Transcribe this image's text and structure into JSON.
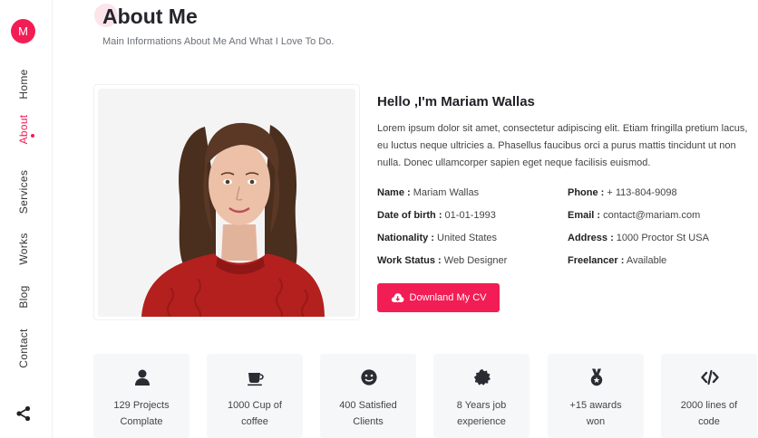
{
  "sidebar": {
    "logo_letter": "M",
    "items": [
      {
        "label": "Home"
      },
      {
        "label": "About"
      },
      {
        "label": "Services"
      },
      {
        "label": "Works"
      },
      {
        "label": "Blog"
      },
      {
        "label": "Contact"
      }
    ],
    "active": "About",
    "share_icon": "share-icon"
  },
  "header": {
    "title": "About Me",
    "subtitle": "Main Informations About Me And What I Love To Do."
  },
  "profile": {
    "greeting": "Hello ,I'm Mariam Wallas",
    "bio": "Lorem ipsum dolor sit amet, consectetur adipiscing elit. Etiam fringilla pretium lacus, eu luctus neque ultricies a. Phasellus faucibus orci a purus mattis tincidunt ut non nulla. Donec ullamcorper sapien eget neque facilisis euismod.",
    "left_info": [
      {
        "label": "Name :",
        "value": " Mariam Wallas"
      },
      {
        "label": "Date of birth :",
        "value": " 01-01-1993"
      },
      {
        "label": "Nationality :",
        "value": " United States"
      },
      {
        "label": "Work Status :",
        "value": " Web Designer"
      }
    ],
    "right_info": [
      {
        "label": "Phone :",
        "value": " + 113-804-9098"
      },
      {
        "label": "Email :",
        "value": " contact@mariam.com"
      },
      {
        "label": "Address :",
        "value": " 1000 Proctor St USA"
      },
      {
        "label": "Freelancer :",
        "value": " Available"
      }
    ],
    "cv_button": "Downland My CV"
  },
  "stats": [
    {
      "icon": "user-icon",
      "line1": "129 Projects",
      "line2": "Complate"
    },
    {
      "icon": "coffee-cup-icon",
      "line1": "1000 Cup of",
      "line2": "coffee"
    },
    {
      "icon": "smile-icon",
      "line1": "400 Satisfied",
      "line2": "Clients"
    },
    {
      "icon": "certificate-icon",
      "line1": "8 Years job",
      "line2": "experience"
    },
    {
      "icon": "medal-icon",
      "line1": "+15 awards",
      "line2": "won"
    },
    {
      "icon": "code-icon",
      "line1": "2000 lines of",
      "line2": "code"
    }
  ],
  "colors": {
    "accent": "#f21d55",
    "stat_bg": "#f6f7f9"
  }
}
